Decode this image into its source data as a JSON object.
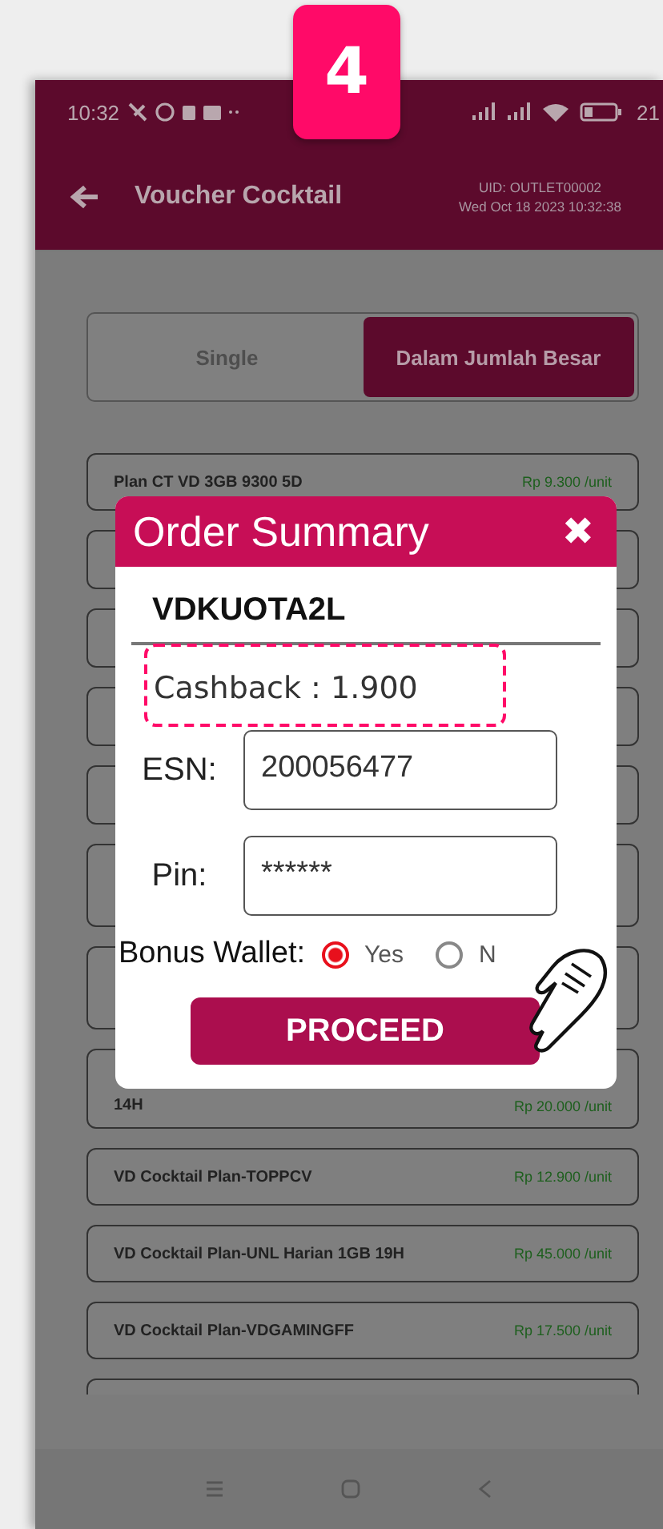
{
  "step_badge": "4",
  "status_bar": {
    "time": "10:32",
    "battery": "21"
  },
  "header": {
    "title": "Voucher Cocktail",
    "uid": "UID: OUTLET00002",
    "datetime": "Wed Oct 18 2023 10:32:38"
  },
  "tabs": [
    {
      "label": "Single",
      "selected": false
    },
    {
      "label": "Dalam Jumlah Besar",
      "selected": true
    }
  ],
  "products_top": [
    {
      "name": "Plan CT VD 3GB 9300 5D",
      "price": "Rp 9.300 /unit"
    }
  ],
  "products_bottom": [
    {
      "name": "14H",
      "price": "Rp 20.000 /unit"
    },
    {
      "name": "VD Cocktail Plan-TOPPCV",
      "price": "Rp 12.900 /unit"
    },
    {
      "name": "VD Cocktail Plan-UNL Harian 1GB 19H",
      "price": "Rp 45.000 /unit"
    },
    {
      "name": "VD Cocktail Plan-VDGAMINGFF",
      "price": "Rp 17.500 /unit"
    }
  ],
  "dialog": {
    "title": "Order Summary",
    "close": "✖",
    "product": "VDKUOTA2L",
    "cashback": "Cashback : 1.900",
    "fields": [
      {
        "label": "ESN:",
        "value": "200056477"
      },
      {
        "label": "Pin:",
        "value": "******"
      }
    ],
    "bonus_label": "Bonus Wallet:",
    "bonus_options": [
      {
        "label": "Yes",
        "selected": true
      },
      {
        "label": "N",
        "selected": false
      }
    ],
    "button": "PROCEED"
  }
}
